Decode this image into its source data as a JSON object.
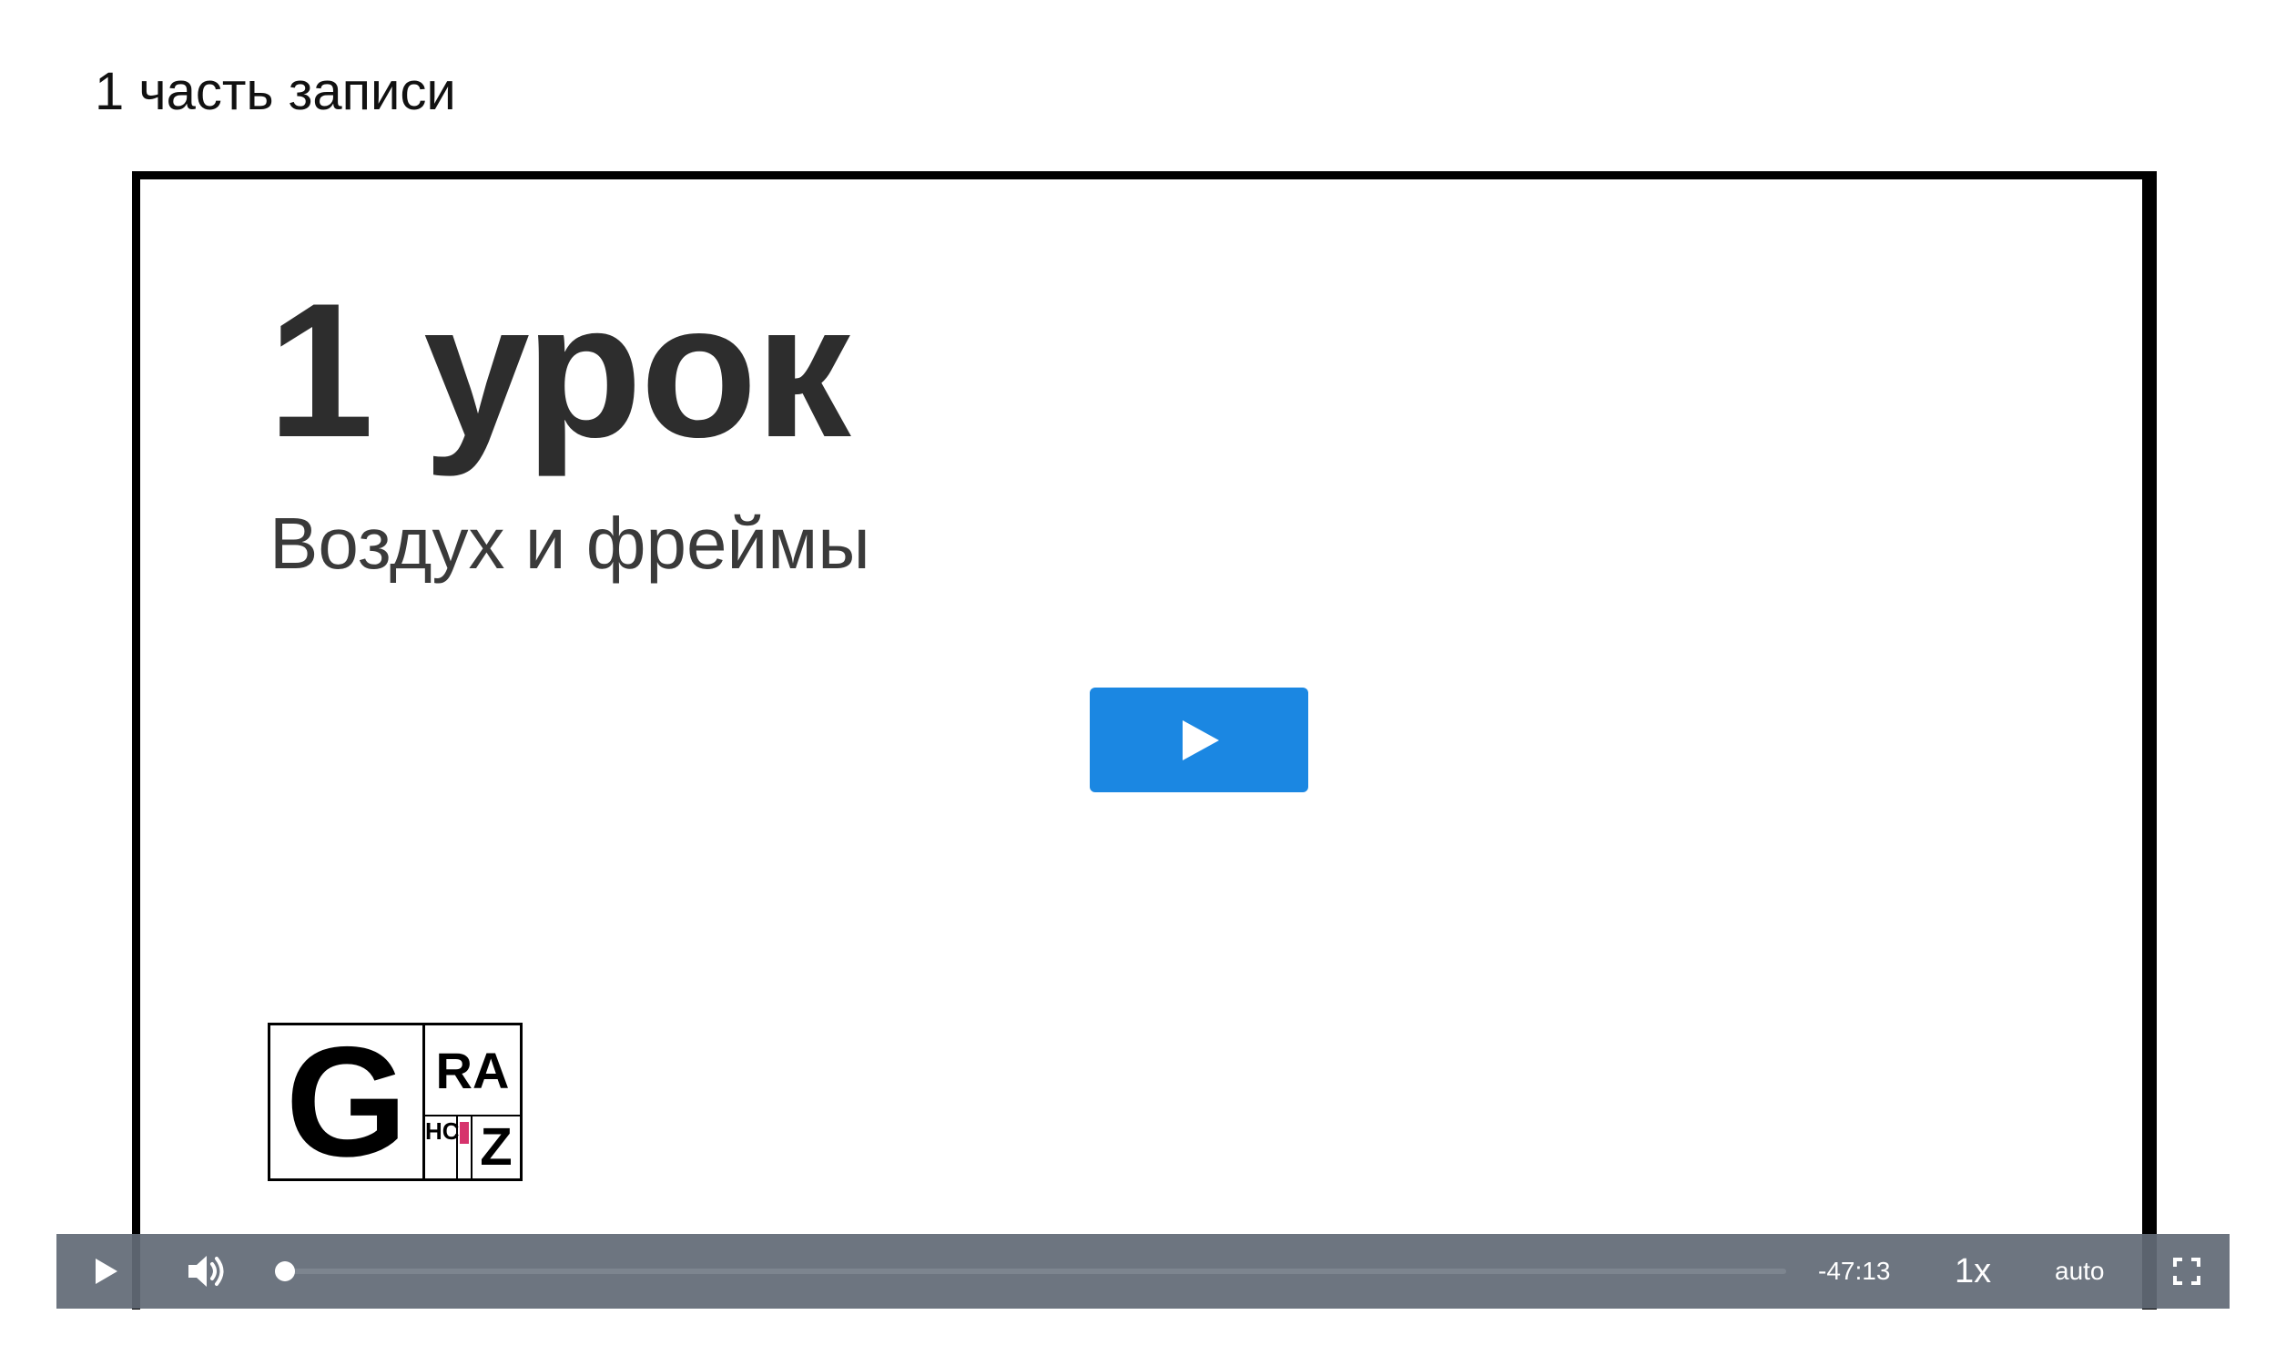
{
  "section": {
    "title": "1 часть записи"
  },
  "video": {
    "slide": {
      "lesson_title": "1 урок",
      "lesson_subtitle": "Воздух и фреймы",
      "logo": {
        "letter": "G",
        "top_right": "RA",
        "bottom_left": "HC",
        "bottom_right": "Z"
      }
    },
    "big_play_icon": "play-icon",
    "accent_color": "#1b87e2"
  },
  "controls": {
    "play_icon": "play-icon",
    "volume_icon": "volume-icon",
    "progress_fraction": 0.0,
    "time_remaining": "-47:13",
    "speed": "1x",
    "quality": "auto",
    "fullscreen_icon": "fullscreen-icon",
    "bar_color": "#626a76"
  }
}
